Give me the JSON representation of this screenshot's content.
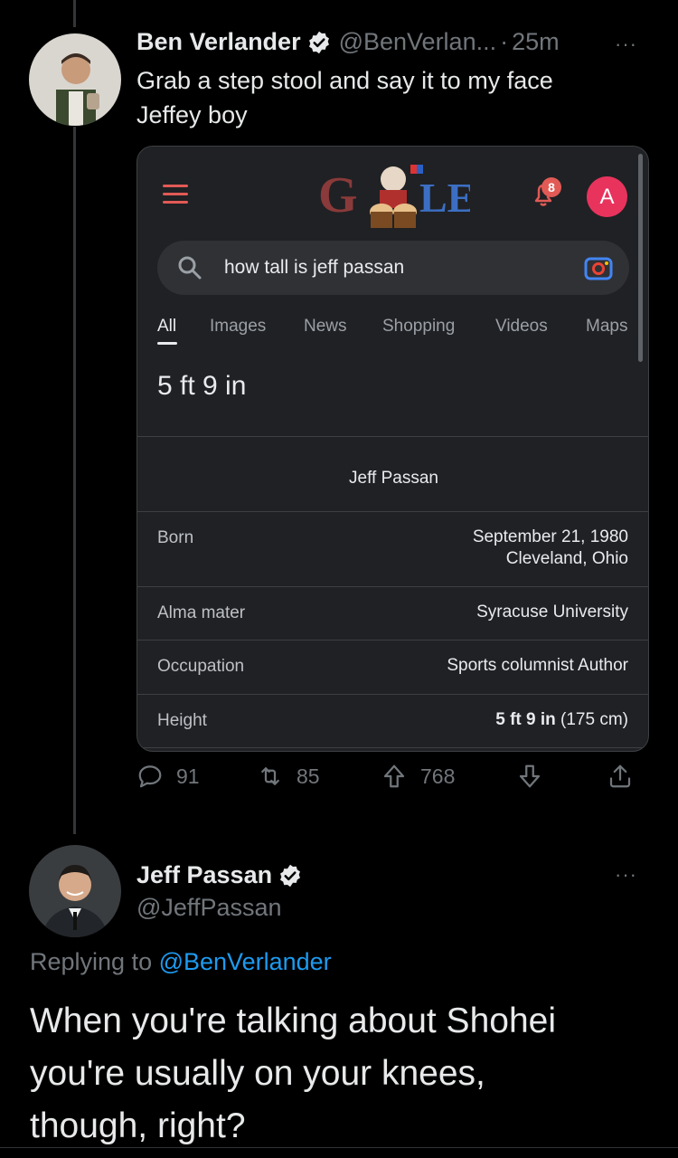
{
  "tweet1": {
    "name": "Ben Verlander",
    "handle": "@BenVerlan...",
    "separator": "·",
    "time": "25m",
    "text_line1": "Grab a step stool and say it to my face",
    "text_line2": "Jeffey boy",
    "more": "···",
    "actions": {
      "reply_count": "91",
      "retweet_count": "85",
      "upvote_count": "768"
    }
  },
  "embedded_search": {
    "notification_count": "8",
    "account_initial": "A",
    "query": "how tall is jeff passan",
    "tabs": [
      {
        "label": "All",
        "active": true
      },
      {
        "label": "Images",
        "active": false
      },
      {
        "label": "News",
        "active": false
      },
      {
        "label": "Shopping",
        "active": false
      },
      {
        "label": "Videos",
        "active": false
      },
      {
        "label": "Maps",
        "active": false
      }
    ],
    "answer": "5 ft 9 in",
    "knowledge_panel": {
      "name": "Jeff Passan",
      "rows": [
        {
          "label": "Born",
          "value_line1": "September 21, 1980",
          "value_line2": "Cleveland, Ohio"
        },
        {
          "label": "Alma mater",
          "value_line1": "Syracuse University"
        },
        {
          "label": "Occupation",
          "value_line1": "Sports columnist Author"
        },
        {
          "label": "Height",
          "value_bold": "5 ft 9 in",
          "value_rest": " (175 cm)"
        }
      ]
    }
  },
  "tweet2": {
    "name": "Jeff Passan",
    "handle": "@JeffPassan",
    "more": "···",
    "replying_prefix": "Replying to ",
    "replying_mention": "@BenVerlander",
    "text_line1": "When you're talking about Shohei",
    "text_line2": "you're usually on your knees,",
    "text_line3": "though, right?"
  },
  "colors": {
    "background": "#000000",
    "text_primary": "#e7e9ea",
    "text_secondary": "#71767b",
    "link_blue": "#1d9bf0",
    "verified_blue": "#1d9bf0",
    "card_bg": "#202124",
    "account_pink": "#e8335d"
  }
}
